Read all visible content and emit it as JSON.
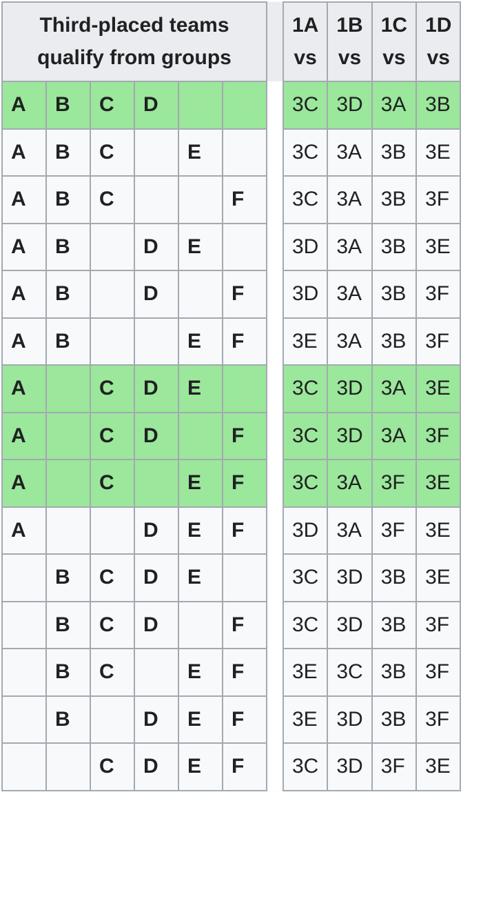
{
  "header": {
    "left": "Third-placed teams qualify from groups",
    "right": [
      "1A",
      "1B",
      "1C",
      "1D"
    ],
    "vs": "vs"
  },
  "groupLetters": [
    "A",
    "B",
    "C",
    "D",
    "E",
    "F"
  ],
  "rows": [
    {
      "groups": [
        "A",
        "B",
        "C",
        "D"
      ],
      "matches": [
        "3C",
        "3D",
        "3A",
        "3B"
      ],
      "highlight": true
    },
    {
      "groups": [
        "A",
        "B",
        "C",
        "E"
      ],
      "matches": [
        "3C",
        "3A",
        "3B",
        "3E"
      ],
      "highlight": false
    },
    {
      "groups": [
        "A",
        "B",
        "C",
        "F"
      ],
      "matches": [
        "3C",
        "3A",
        "3B",
        "3F"
      ],
      "highlight": false
    },
    {
      "groups": [
        "A",
        "B",
        "D",
        "E"
      ],
      "matches": [
        "3D",
        "3A",
        "3B",
        "3E"
      ],
      "highlight": false
    },
    {
      "groups": [
        "A",
        "B",
        "D",
        "F"
      ],
      "matches": [
        "3D",
        "3A",
        "3B",
        "3F"
      ],
      "highlight": false
    },
    {
      "groups": [
        "A",
        "B",
        "E",
        "F"
      ],
      "matches": [
        "3E",
        "3A",
        "3B",
        "3F"
      ],
      "highlight": false
    },
    {
      "groups": [
        "A",
        "C",
        "D",
        "E"
      ],
      "matches": [
        "3C",
        "3D",
        "3A",
        "3E"
      ],
      "highlight": true
    },
    {
      "groups": [
        "A",
        "C",
        "D",
        "F"
      ],
      "matches": [
        "3C",
        "3D",
        "3A",
        "3F"
      ],
      "highlight": true
    },
    {
      "groups": [
        "A",
        "C",
        "E",
        "F"
      ],
      "matches": [
        "3C",
        "3A",
        "3F",
        "3E"
      ],
      "highlight": true
    },
    {
      "groups": [
        "A",
        "D",
        "E",
        "F"
      ],
      "matches": [
        "3D",
        "3A",
        "3F",
        "3E"
      ],
      "highlight": false
    },
    {
      "groups": [
        "B",
        "C",
        "D",
        "E"
      ],
      "matches": [
        "3C",
        "3D",
        "3B",
        "3E"
      ],
      "highlight": false
    },
    {
      "groups": [
        "B",
        "C",
        "D",
        "F"
      ],
      "matches": [
        "3C",
        "3D",
        "3B",
        "3F"
      ],
      "highlight": false
    },
    {
      "groups": [
        "B",
        "C",
        "E",
        "F"
      ],
      "matches": [
        "3E",
        "3C",
        "3B",
        "3F"
      ],
      "highlight": false
    },
    {
      "groups": [
        "B",
        "D",
        "E",
        "F"
      ],
      "matches": [
        "3E",
        "3D",
        "3B",
        "3F"
      ],
      "highlight": false
    },
    {
      "groups": [
        "C",
        "D",
        "E",
        "F"
      ],
      "matches": [
        "3C",
        "3D",
        "3F",
        "3E"
      ],
      "highlight": false
    }
  ]
}
